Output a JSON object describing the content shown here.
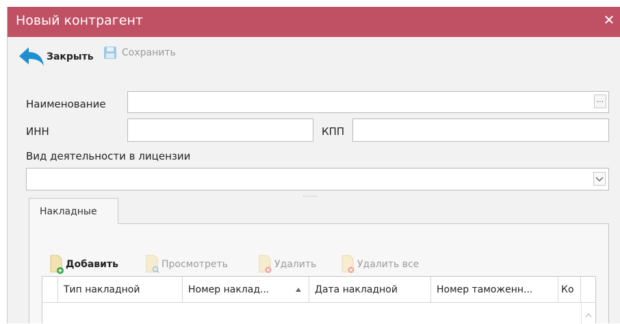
{
  "window": {
    "title": "Новый контрагент"
  },
  "toolbar": {
    "close_label": "Закрыть",
    "save_label": "Сохранить"
  },
  "form": {
    "name_label": "Наименование",
    "inn_label": "ИНН",
    "kpp_label": "КПП",
    "activity_label": "Вид деятельности в лицензии"
  },
  "tabs": [
    {
      "label": "Накладные"
    }
  ],
  "grid_toolbar": {
    "add_label": "Добавить",
    "view_label": "Просмотреть",
    "delete_label": "Удалить",
    "delete_all_label": "Удалить все"
  },
  "table": {
    "columns": [
      "Тип накладной",
      "Номер наклад...",
      "Дата накладной",
      "Номер таможенн...",
      "Ко"
    ]
  },
  "colors": {
    "title_bar": "#c05064",
    "error_icon": "#e0522a",
    "toolbar_arrow": "#1f8fd1"
  }
}
